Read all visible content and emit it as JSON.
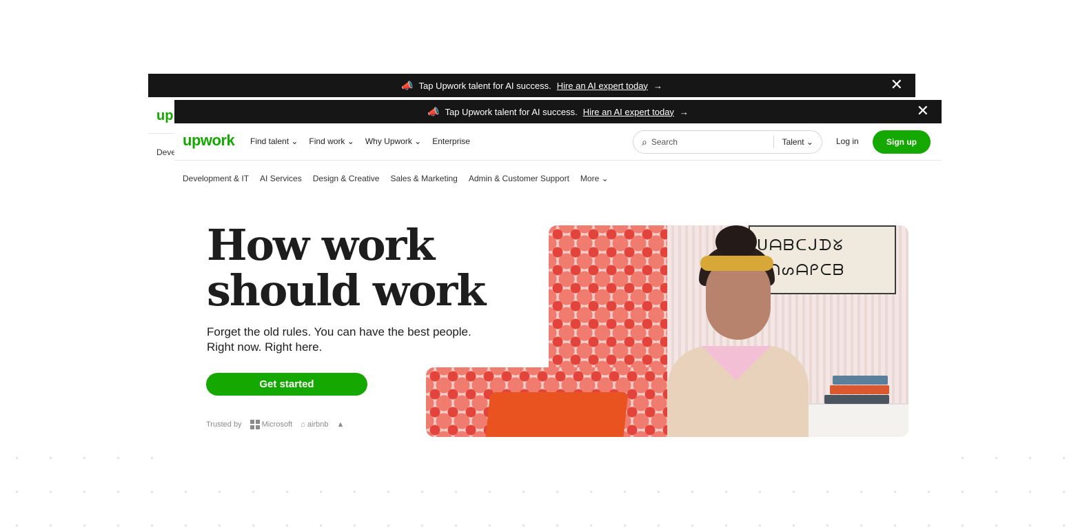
{
  "banner": {
    "text": "Tap Upwork talent for AI success.",
    "link": "Hire an AI expert today",
    "arrow": "→",
    "close_icon": "close-icon",
    "megaphone_icon": "megaphone-icon"
  },
  "back_frame": {
    "logo_peek": "up",
    "category_peek": "Deve"
  },
  "nav": {
    "logo": "upwork",
    "links": [
      "Find talent ⌄",
      "Find work ⌄",
      "Why Upwork ⌄",
      "Enterprise"
    ],
    "search_placeholder": "Search",
    "search_scope": "Talent ⌄",
    "login": "Log in",
    "signup": "Sign up"
  },
  "categories": [
    "Development & IT",
    "AI Services",
    "Design & Creative",
    "Sales & Marketing",
    "Admin & Customer Support",
    "More ⌄"
  ],
  "hero": {
    "title_line1": "How work",
    "title_line2": "should work",
    "subtitle_line1": "Forget the old rules. You can have the best people.",
    "subtitle_line2": "Right now. Right here.",
    "cta": "Get started",
    "trusted_by": "Trusted by",
    "brands": [
      "Microsoft",
      "airbnb"
    ]
  },
  "colors": {
    "brand_green": "#14a800",
    "banner_bg": "#161616"
  }
}
